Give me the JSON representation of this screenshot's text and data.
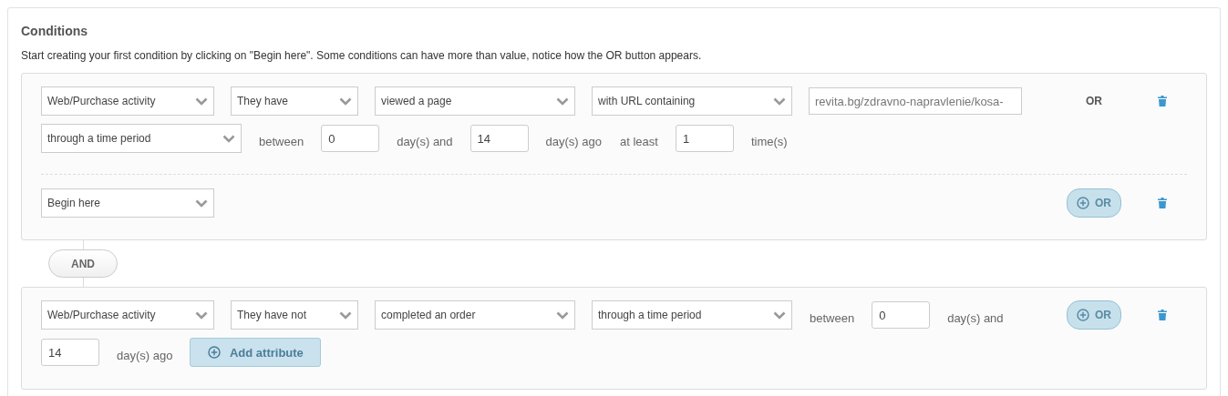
{
  "panel": {
    "title": "Conditions",
    "description": "Start creating your first condition by clicking on \"Begin here\". Some conditions can have more than value, notice how the OR button appears."
  },
  "groups": [
    {
      "conditions": [
        {
          "fields": [
            {
              "kind": "select",
              "value": "Web/Purchase activity"
            },
            {
              "kind": "select",
              "value": "They have"
            },
            {
              "kind": "select",
              "value": "viewed a page"
            },
            {
              "kind": "select",
              "value": "with URL containing"
            },
            {
              "kind": "url",
              "value": "revita.bg/zdravno-napravlenie/kosa-"
            },
            {
              "kind": "select",
              "value": "through a time period"
            },
            {
              "kind": "text",
              "label": "between"
            },
            {
              "kind": "number",
              "value": "0"
            },
            {
              "kind": "text",
              "label": "day(s) and"
            },
            {
              "kind": "number",
              "value": "14"
            },
            {
              "kind": "text",
              "label": "day(s) ago"
            },
            {
              "kind": "text",
              "label": "at least"
            },
            {
              "kind": "number",
              "value": "1"
            },
            {
              "kind": "text",
              "label": "time(s)"
            }
          ],
          "action": {
            "kind": "label",
            "label": "OR"
          }
        },
        {
          "fields": [
            {
              "kind": "select",
              "value": "Begin here"
            }
          ],
          "action": {
            "kind": "button",
            "label": "OR"
          }
        }
      ]
    },
    {
      "join_label": "AND",
      "conditions": [
        {
          "fields": [
            {
              "kind": "select",
              "value": "Web/Purchase activity"
            },
            {
              "kind": "select",
              "value": "They have not"
            },
            {
              "kind": "select",
              "value": "completed an order"
            },
            {
              "kind": "select",
              "value": "through a time period"
            },
            {
              "kind": "text",
              "label": "between"
            },
            {
              "kind": "number",
              "value": "0"
            },
            {
              "kind": "text",
              "label": "day(s) and"
            },
            {
              "kind": "number",
              "value": "14"
            },
            {
              "kind": "text",
              "label": "day(s) ago"
            },
            {
              "kind": "button",
              "label": "Add attribute"
            }
          ],
          "action": {
            "kind": "button",
            "label": "OR"
          }
        }
      ]
    }
  ]
}
